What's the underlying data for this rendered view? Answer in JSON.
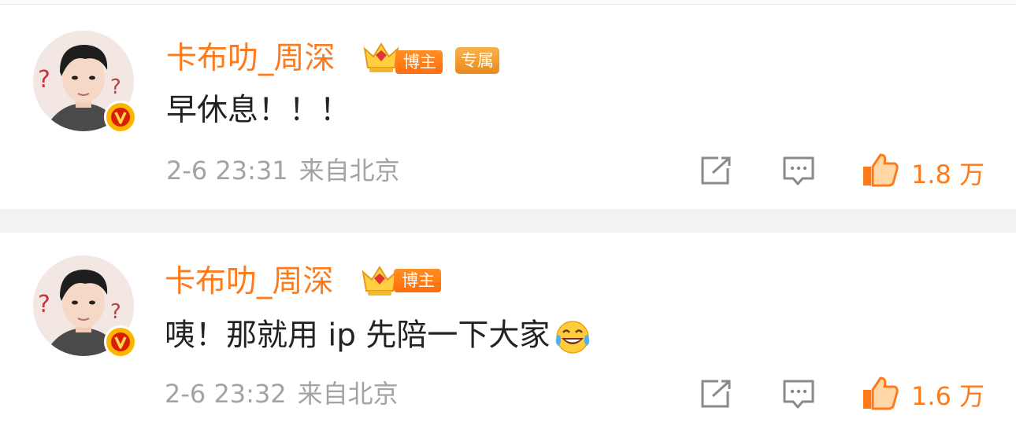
{
  "comments": [
    {
      "username": "卡布叻_周深",
      "badge_blogger": "博主",
      "badge_exclusive": "专属",
      "text": "早休息！！！",
      "time": "2-6 23:31",
      "location": "来自北京",
      "likes": "1.8 万",
      "icons": [
        "repost-icon",
        "comment-icon",
        "like-icon"
      ]
    },
    {
      "username": "卡布叻_周深",
      "badge_blogger": "博主",
      "text": "咦！那就用 ip 先陪一下大家",
      "emoji": "laughing-tears-emoji",
      "time": "2-6 23:32",
      "location": "来自北京",
      "likes": "1.6 万",
      "icons": [
        "repost-icon",
        "comment-icon",
        "like-icon"
      ]
    }
  ],
  "colors": {
    "username": "#ff7a1a",
    "like": "#ff7a1a",
    "meta": "#a3a3a3",
    "text": "#222222",
    "badge_blogger": "#ff7a16",
    "badge_exclusive": "#f0a238",
    "verified_badge": "#ffb400",
    "divider": "#f2f2f2"
  }
}
